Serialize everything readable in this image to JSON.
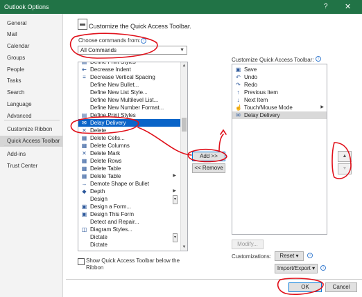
{
  "window": {
    "title": "Outlook Options",
    "help": "?",
    "close": "✕"
  },
  "nav": [
    {
      "label": "General",
      "selected": false
    },
    {
      "label": "Mail",
      "selected": false
    },
    {
      "label": "Calendar",
      "selected": false
    },
    {
      "label": "Groups",
      "selected": false
    },
    {
      "label": "People",
      "selected": false
    },
    {
      "label": "Tasks",
      "selected": false
    },
    {
      "label": "Search",
      "selected": false
    },
    {
      "label": "Language",
      "selected": false
    },
    {
      "label": "Advanced",
      "selected": false
    },
    {
      "label": "Customize Ribbon",
      "selected": false
    },
    {
      "label": "Quick Access Toolbar",
      "selected": true
    },
    {
      "label": "Add-ins",
      "selected": false
    },
    {
      "label": "Trust Center",
      "selected": false
    }
  ],
  "header": {
    "title": "Customize the Quick Access Toolbar."
  },
  "choose": {
    "label": "Choose commands from:",
    "value": "All Commands"
  },
  "commands": [
    {
      "label": "Define Print Styles",
      "icon": "printer-icon",
      "glyph": "▤"
    },
    {
      "label": "Decrease Indent",
      "icon": "decrease-indent-icon",
      "glyph": "⇤"
    },
    {
      "label": "Decrease Vertical Spacing",
      "icon": "spacing-icon",
      "glyph": "≡"
    },
    {
      "label": "Define New Bullet...",
      "icon": "blank-icon",
      "glyph": ""
    },
    {
      "label": "Define New List Style...",
      "icon": "blank-icon",
      "glyph": ""
    },
    {
      "label": "Define New Multilevel List...",
      "icon": "blank-icon",
      "glyph": ""
    },
    {
      "label": "Define New Number Format...",
      "icon": "blank-icon",
      "glyph": ""
    },
    {
      "label": "Define Print Styles",
      "icon": "printer-icon",
      "glyph": "▤"
    },
    {
      "label": "Delay Delivery",
      "icon": "clock-envelope-icon",
      "glyph": "✉"
    },
    {
      "label": "Delete",
      "icon": "delete-icon",
      "glyph": "✕"
    },
    {
      "label": "Delete Cells...",
      "icon": "table-icon",
      "glyph": "▦"
    },
    {
      "label": "Delete Columns",
      "icon": "table-icon",
      "glyph": "▦"
    },
    {
      "label": "Delete Mark",
      "icon": "mark-icon",
      "glyph": "✕"
    },
    {
      "label": "Delete Rows",
      "icon": "table-icon",
      "glyph": "▦"
    },
    {
      "label": "Delete Table",
      "icon": "table-icon",
      "glyph": "▦"
    },
    {
      "label": "Delete Table",
      "icon": "table-icon",
      "glyph": "▦",
      "submenu": true
    },
    {
      "label": "Demote Shape or Bullet",
      "icon": "arrow-right-icon",
      "glyph": "→"
    },
    {
      "label": "Depth",
      "icon": "depth-icon",
      "glyph": "◆",
      "submenu": true
    },
    {
      "label": "Design",
      "icon": "blank-icon",
      "glyph": "",
      "dropdown": true
    },
    {
      "label": "Design a Form...",
      "icon": "form-icon",
      "glyph": "▣"
    },
    {
      "label": "Design This Form",
      "icon": "form-icon",
      "glyph": "▣"
    },
    {
      "label": "Detect and Repair...",
      "icon": "blank-icon",
      "glyph": ""
    },
    {
      "label": "Diagram Styles...",
      "icon": "diagram-icon",
      "glyph": "◫"
    },
    {
      "label": "Dictate",
      "icon": "blank-icon",
      "glyph": "",
      "dropdown": true
    },
    {
      "label": "Dictate",
      "icon": "blank-icon",
      "glyph": ""
    }
  ],
  "add_button": "Add >>",
  "remove_button": "<< Remove",
  "customize": {
    "label": "Customize Quick Access Toolbar:"
  },
  "toolbar_items": [
    {
      "label": "Save",
      "icon": "save-icon",
      "glyph": "▣"
    },
    {
      "label": "Undo",
      "icon": "undo-icon",
      "glyph": "↶"
    },
    {
      "label": "Redo",
      "icon": "redo-icon",
      "glyph": "↷"
    },
    {
      "label": "Previous Item",
      "icon": "arrow-up-icon",
      "glyph": "↑"
    },
    {
      "label": "Next Item",
      "icon": "arrow-down-icon",
      "glyph": "↓"
    },
    {
      "label": "Touch/Mouse Mode",
      "icon": "touch-icon",
      "glyph": "☝",
      "submenu": true
    },
    {
      "label": "Delay Delivery",
      "icon": "clock-envelope-icon",
      "glyph": "✉"
    }
  ],
  "modify_button": "Modify...",
  "show_below": "Show Quick Access Toolbar below the Ribbon",
  "customizations": {
    "label": "Customizations:",
    "reset": "Reset ▾",
    "import_export": "Import/Export ▾"
  },
  "ok_button": "OK",
  "cancel_button": "Cancel",
  "colors": {
    "accent": "#217346",
    "selection": "#0a64c8",
    "annotation": "#e0101a"
  }
}
